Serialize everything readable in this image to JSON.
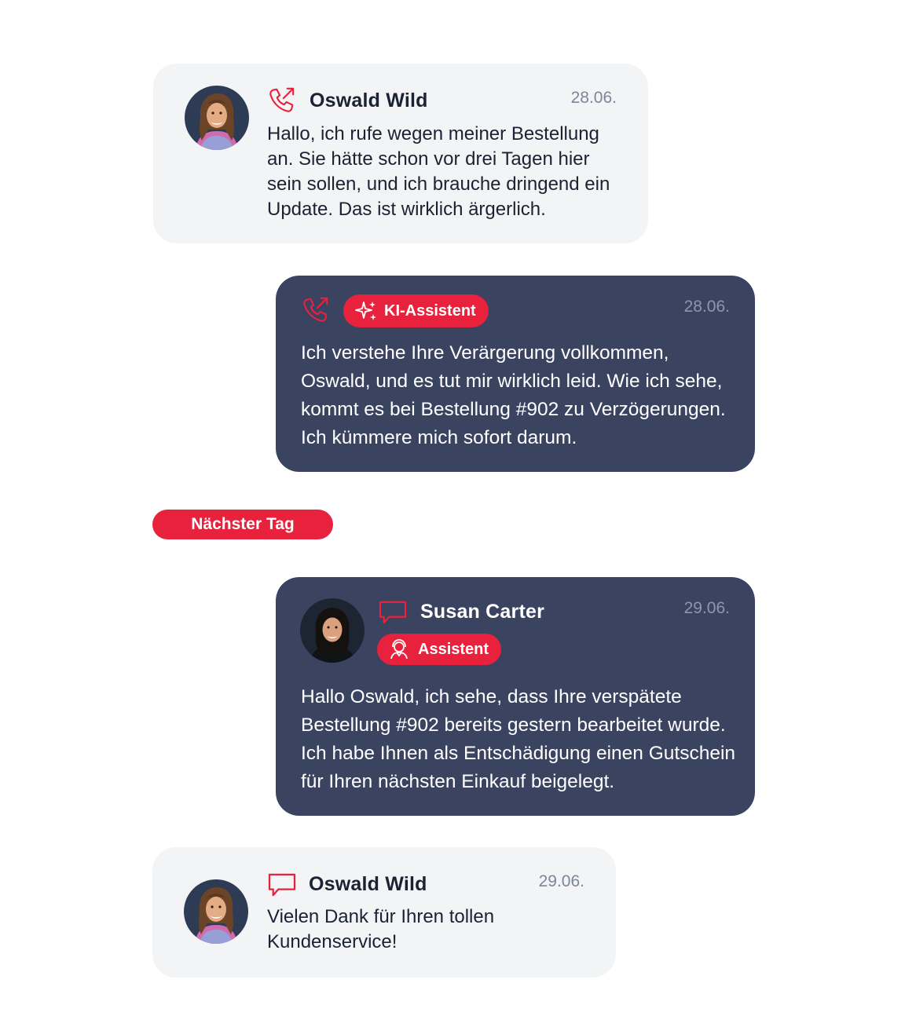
{
  "colors": {
    "accent": "#e8213c",
    "dark_card": "#3a4461",
    "light_card": "#f2f4f6",
    "date_text": "#7c8699"
  },
  "messages": [
    {
      "name": "Oswald Wild",
      "date": "28.06.",
      "channel_icon": "phone-call-icon",
      "text": "Hallo, ich rufe wegen meiner Bestellung an. Sie hätte schon vor drei Tagen hier sein sollen, und ich brauche dringend ein Update. Das ist wirklich ärgerlich."
    },
    {
      "badge": "KI-Assistent",
      "badge_icon": "sparkles-icon",
      "date": "28.06.",
      "channel_icon": "phone-call-icon",
      "text": "Ich verstehe Ihre Verärgerung vollkommen, Oswald, und es tut mir wirklich leid. Wie ich sehe, kommt es bei Bestellung #902 zu Verzögerungen. Ich kümmere mich sofort darum."
    },
    {
      "name": "Susan Carter",
      "badge": "Assistent",
      "badge_icon": "agent-icon",
      "date": "29.06.",
      "channel_icon": "chat-bubble-icon",
      "text": "Hallo Oswald, ich sehe, dass Ihre verspätete Bestellung #902 bereits gestern bearbeitet wurde. Ich habe Ihnen als Entschädigung einen Gutschein für Ihren nächsten Einkauf beigelegt."
    },
    {
      "name": "Oswald Wild",
      "date": "29.06.",
      "channel_icon": "chat-bubble-icon",
      "text": "Vielen Dank für Ihren tollen Kundenservice!"
    }
  ],
  "divider": {
    "label": "Nächster Tag"
  }
}
